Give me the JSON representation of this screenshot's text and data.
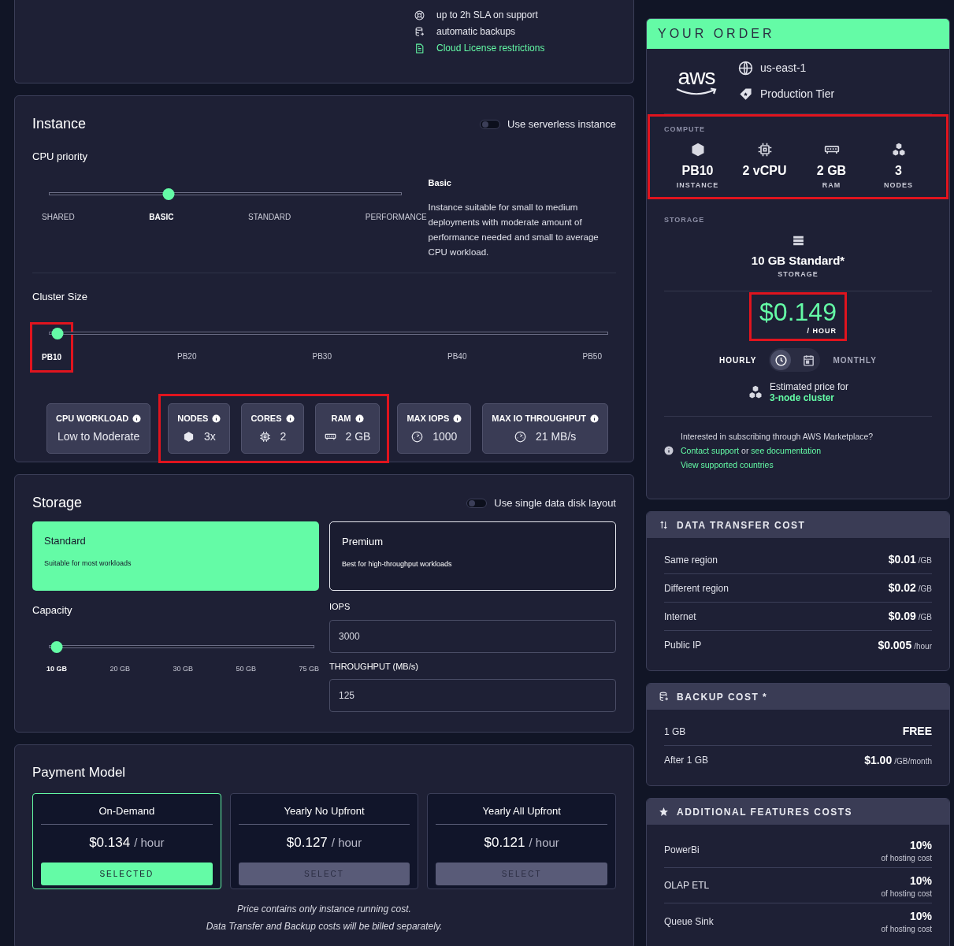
{
  "plan_features": [
    {
      "kind": "support",
      "text": "up to 2h SLA on support",
      "link": false
    },
    {
      "kind": "backup",
      "text": "automatic backups",
      "link": false
    },
    {
      "kind": "document",
      "text": "Cloud License restrictions",
      "link": true
    }
  ],
  "instance": {
    "title": "Instance",
    "serverless_toggle": {
      "label": "Use serverless instance",
      "on": false
    },
    "cpu_priority": {
      "label": "CPU priority",
      "level": 0.34,
      "options": [
        {
          "label": "SHARED",
          "selected": false
        },
        {
          "label": "BASIC",
          "selected": true
        },
        {
          "label": "STANDARD",
          "selected": false
        },
        {
          "label": "PERFORMANCE",
          "selected": false
        }
      ]
    },
    "description": {
      "title": "Basic",
      "text": "Instance suitable for small to medium deployments with moderate amount of performance needed and small to average CPU workload."
    },
    "cluster_size": {
      "label": "Cluster Size",
      "level": 0.015,
      "options": [
        {
          "label": "PB10",
          "selected": true,
          "highlighted": true
        },
        {
          "label": "PB20",
          "selected": false,
          "highlighted": false
        },
        {
          "label": "PB30",
          "selected": false,
          "highlighted": false
        },
        {
          "label": "PB40",
          "selected": false,
          "highlighted": false
        },
        {
          "label": "PB50",
          "selected": false,
          "highlighted": false
        }
      ]
    },
    "spec_groups": [
      {
        "highlighted": false,
        "items": [
          {
            "kind": "workload",
            "label": "CPU WORKLOAD",
            "value": "Low to Moderate"
          }
        ]
      },
      {
        "highlighted": true,
        "items": [
          {
            "kind": "nodes",
            "label": "NODES",
            "value": "3x"
          },
          {
            "kind": "cores",
            "label": "CORES",
            "value": "2"
          },
          {
            "kind": "ram",
            "label": "RAM",
            "value": "2 GB"
          }
        ]
      },
      {
        "highlighted": false,
        "items": [
          {
            "kind": "iops",
            "label": "MAX IOPS",
            "value": "1000"
          },
          {
            "kind": "throughput",
            "label": "MAX IO THROUGHPUT",
            "value": "21 MB/s"
          }
        ]
      }
    ]
  },
  "storage": {
    "title": "Storage",
    "single_disk_toggle": {
      "label": "Use single data disk layout",
      "on": false
    },
    "types": [
      {
        "name": "Standard",
        "description": "Suitable for most workloads",
        "selected": true
      },
      {
        "name": "Premium",
        "description": "Best for high-throughput workloads",
        "selected": false
      }
    ],
    "capacity": {
      "label": "Capacity",
      "level": 0.03,
      "options": [
        {
          "label": "10 GB",
          "selected": true
        },
        {
          "label": "20 GB",
          "selected": false
        },
        {
          "label": "30 GB",
          "selected": false
        },
        {
          "label": "50 GB",
          "selected": false
        },
        {
          "label": "75 GB",
          "selected": false
        }
      ]
    },
    "fields": [
      {
        "label": "IOPS",
        "value": "3000"
      },
      {
        "label": "THROUGHPUT (MB/s)",
        "value": "125"
      }
    ]
  },
  "payment_model": {
    "title": "Payment Model",
    "plans": [
      {
        "name": "On-Demand",
        "price": "$0.134",
        "unit": "/ hour",
        "button_label": "SELECTED",
        "selected": true
      },
      {
        "name": "Yearly No Upfront",
        "price": "$0.127",
        "unit": "/ hour",
        "button_label": "SELECT",
        "selected": false
      },
      {
        "name": "Yearly All Upfront",
        "price": "$0.121",
        "unit": "/ hour",
        "button_label": "SELECT",
        "selected": false
      }
    ],
    "notes": [
      "Price contains only instance running cost.",
      "Data Transfer and Backup costs will be billed separately."
    ]
  },
  "order": {
    "title": "YOUR ORDER",
    "logo_text": "aws",
    "region": "us-east-1",
    "tier": "Production Tier",
    "compute": {
      "label": "COMPUTE",
      "highlighted": true,
      "items": [
        {
          "kind": "instance",
          "value": "PB10",
          "caption": "INSTANCE"
        },
        {
          "kind": "cpu",
          "value": "2 vCPU"
        },
        {
          "kind": "ram",
          "value": "2 GB",
          "caption": "RAM"
        },
        {
          "kind": "nodes",
          "value": "3",
          "caption": "NODES"
        }
      ]
    },
    "storage": {
      "label": "STORAGE",
      "value": "10 GB Standard*",
      "caption": "STORAGE"
    },
    "price": {
      "value": "$0.149",
      "unit": "/ HOUR",
      "highlighted": true
    },
    "periods": [
      {
        "label": "HOURLY",
        "kind": "clock",
        "selected": true
      },
      {
        "label": "MONTHLY",
        "kind": "calendar",
        "selected": false
      }
    ],
    "estimate": {
      "text": "Estimated price for",
      "link": "3-node cluster"
    },
    "marketplace_note": [
      {
        "text": "Interested in subscribing through AWS Marketplace?",
        "link": false
      },
      {
        "text": "Contact support",
        "link": true
      },
      {
        "text": "or",
        "link": false
      },
      {
        "text": "see documentation",
        "link": true
      }
    ],
    "countries_link": "View supported countries"
  },
  "cost_cards": [
    {
      "kind": "transfer",
      "title": "DATA TRANSFER COST",
      "rows": [
        {
          "label": "Same region",
          "price": "$0.01",
          "unit": "/GB"
        },
        {
          "label": "Different region",
          "price": "$0.02",
          "unit": "/GB"
        },
        {
          "label": "Internet",
          "price": "$0.09",
          "unit": "/GB"
        },
        {
          "label": "Public IP",
          "price": "$0.005",
          "unit": "/hour"
        }
      ]
    },
    {
      "kind": "backup",
      "title": "BACKUP COST *",
      "rows": [
        {
          "label": "1 GB",
          "price": "FREE"
        },
        {
          "label": "After 1 GB",
          "price": "$1.00",
          "unit": "/GB/month"
        }
      ]
    },
    {
      "kind": "star",
      "title": "ADDITIONAL FEATURES COSTS",
      "rows": [
        {
          "label": "PowerBi",
          "price": "10%",
          "note": "of hosting cost"
        },
        {
          "label": "OLAP ETL",
          "price": "10%",
          "note": "of hosting cost"
        },
        {
          "label": "Queue Sink",
          "price": "10%",
          "note": "of hosting cost"
        }
      ]
    }
  ]
}
